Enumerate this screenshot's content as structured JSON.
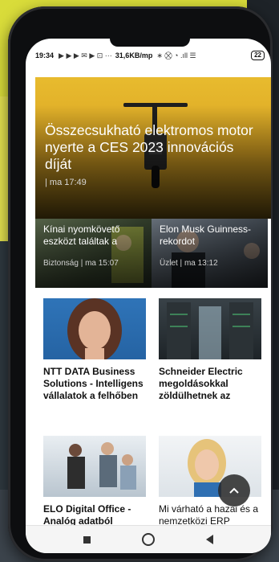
{
  "status_bar": {
    "time": "19:34",
    "icons_left": "▶ ▶ ▶ ✉ ▶ ⊡ ···",
    "speed": "31,6KB/mp",
    "icons_right": "∗ ⛒ ◔ .ıll ☰",
    "battery": "22"
  },
  "hero": {
    "title": "Összecsukható elektromos motor nyerte a CES 2023 innovációs díját",
    "meta": "| ma 17:49"
  },
  "sub_articles": [
    {
      "title": "Kínai nyomkövető eszközt találtak a",
      "meta": "Biztonság | ma 15:07"
    },
    {
      "title": "Elon Musk Guinness-rekordot",
      "meta": "Üzlet | ma 13:12"
    }
  ],
  "cards": [
    {
      "title": "NTT DATA Business Solutions - Intelligens vállalatok a felhőben"
    },
    {
      "title": "Schneider Electric megoldásokkal zöldülhetnek az"
    },
    {
      "title": "ELO Digital Office - Analóg adatból"
    },
    {
      "title": "Mi várható a hazai és a nemzetközi ERP"
    }
  ],
  "icons": {
    "scroll_top": "chevron-up-icon",
    "nav_recent": "square-icon",
    "nav_home": "circle-icon",
    "nav_back": "triangle-back-icon"
  },
  "colors": {
    "background": "#2f3940",
    "hero_yellow": "#e8bb2e",
    "card_text": "#111111"
  }
}
